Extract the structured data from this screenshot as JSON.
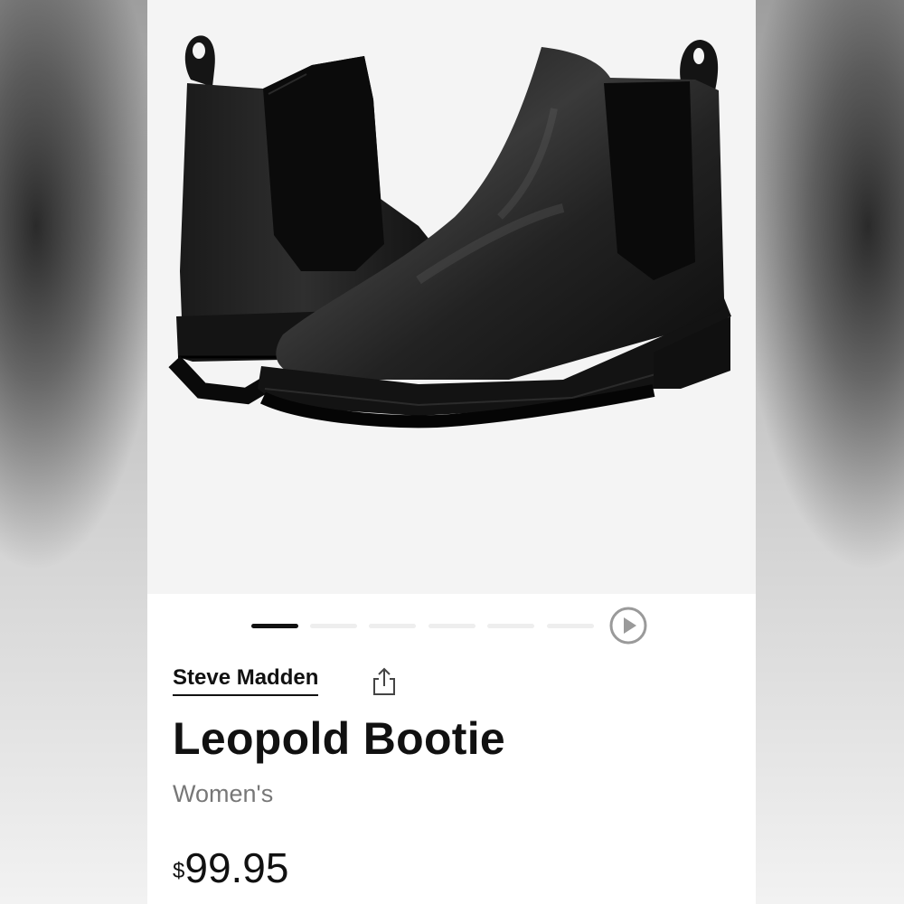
{
  "product": {
    "brand": "Steve Madden",
    "name": "Leopold Bootie",
    "gender": "Women's",
    "price_symbol": "$",
    "price_amount": "99.95"
  },
  "gallery": {
    "image_subject": "black leather chelsea boots",
    "dots_total": 6,
    "active_dot": 1
  },
  "icons": {
    "share": "share-icon",
    "play": "play-icon"
  },
  "colors": {
    "text": "#111111",
    "muted": "#777777",
    "pager_inactive": "#eeeeee",
    "pager_active": "#111111",
    "hero_bg": "#f4f4f4"
  }
}
